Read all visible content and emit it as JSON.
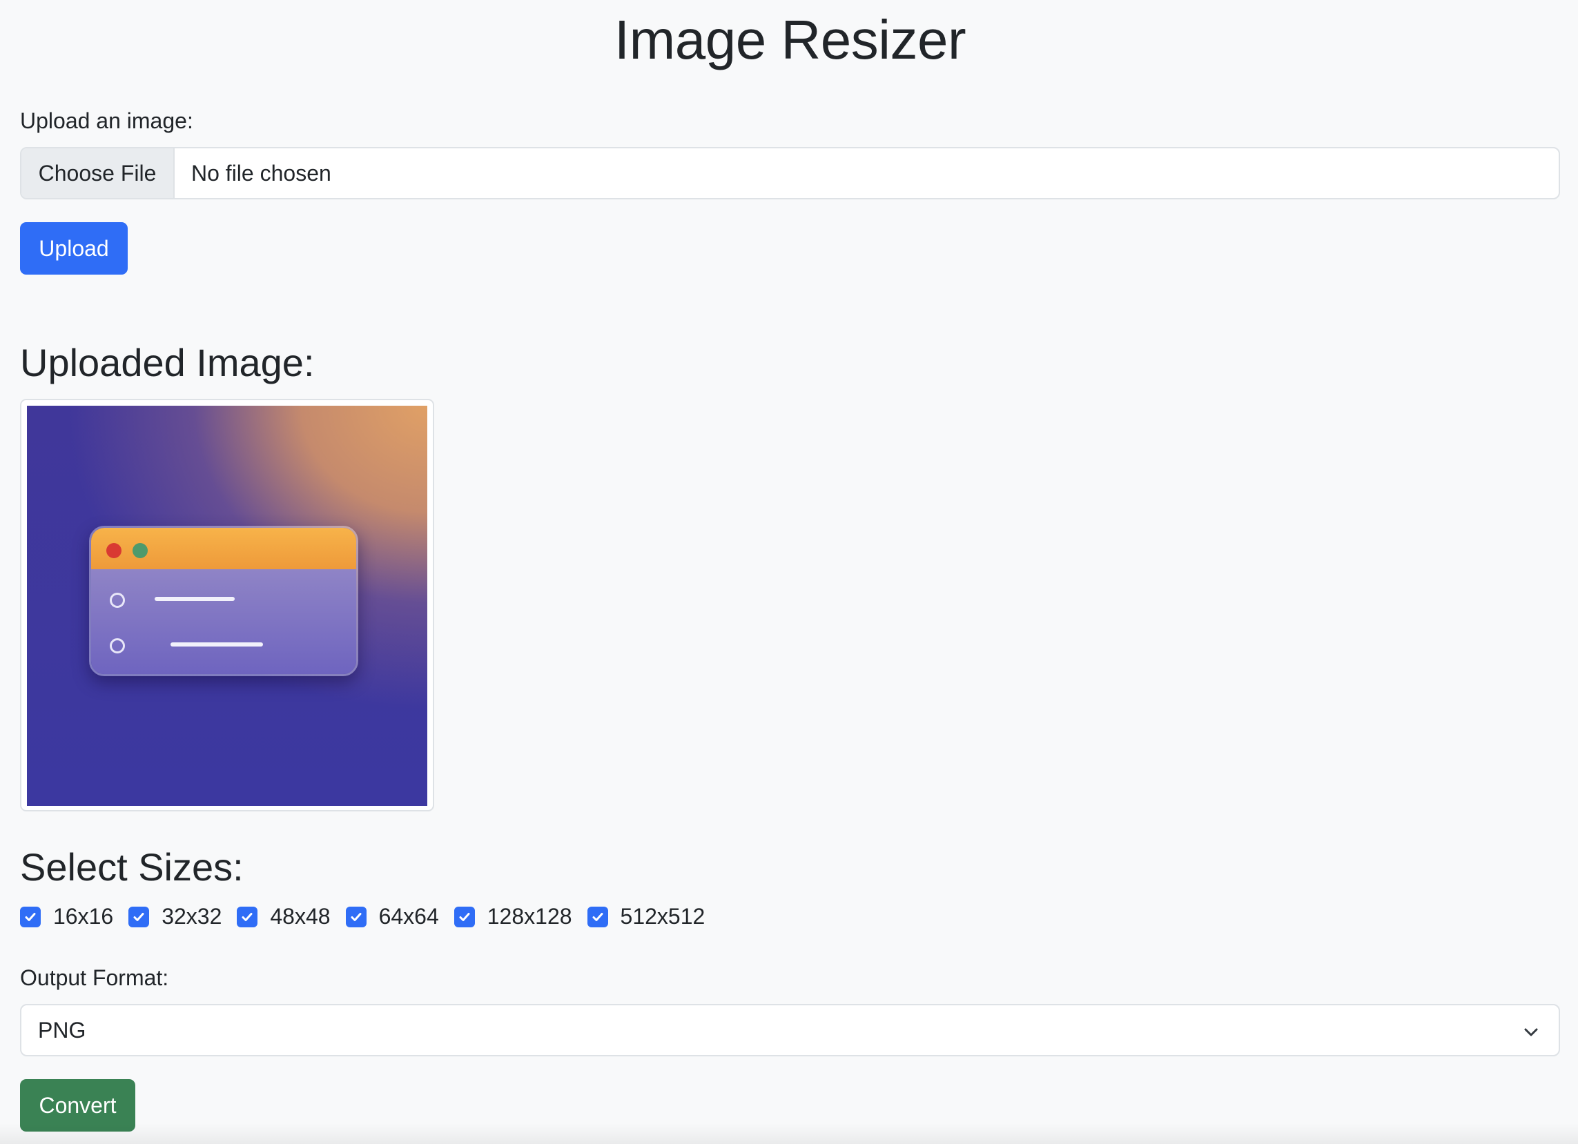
{
  "page": {
    "title": "Image Resizer"
  },
  "upload": {
    "label": "Upload an image:",
    "choose_button": "Choose File",
    "file_status": "No file chosen",
    "upload_button": "Upload"
  },
  "uploaded": {
    "heading": "Uploaded Image:"
  },
  "sizes": {
    "heading": "Select Sizes:",
    "options": [
      {
        "label": "16x16",
        "checked": true
      },
      {
        "label": "32x32",
        "checked": true
      },
      {
        "label": "48x48",
        "checked": true
      },
      {
        "label": "64x64",
        "checked": true
      },
      {
        "label": "128x128",
        "checked": true
      },
      {
        "label": "512x512",
        "checked": true
      }
    ]
  },
  "output": {
    "label": "Output Format:",
    "selected": "PNG",
    "convert_button": "Convert"
  },
  "colors": {
    "primary": "#2f6df6",
    "success": "#3a8254",
    "background": "#f8f9fa"
  },
  "icons": {
    "checkbox": "check-icon",
    "select": "chevron-down-icon"
  }
}
